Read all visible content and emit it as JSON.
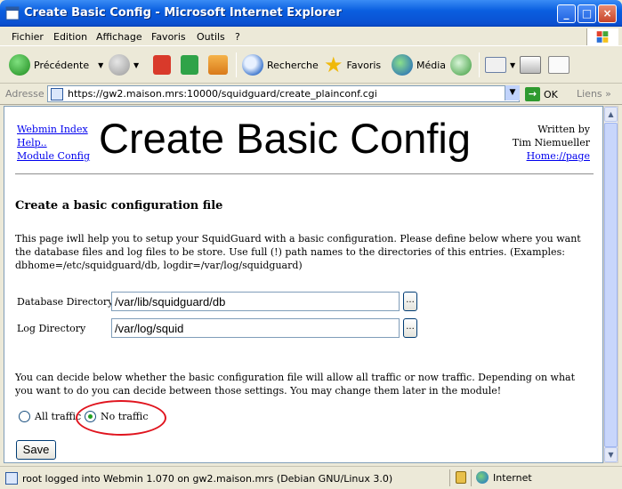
{
  "window": {
    "title": "Create Basic Config - Microsoft Internet Explorer",
    "minimize": "_",
    "maximize": "□",
    "close": "×"
  },
  "menu": [
    "Fichier",
    "Edition",
    "Affichage",
    "Favoris",
    "Outils",
    "?"
  ],
  "toolbar": {
    "back": "Précédente",
    "search": "Recherche",
    "favorites": "Favoris",
    "media": "Média"
  },
  "address": {
    "label": "Adresse",
    "url": "https://gw2.maison.mrs:10000/squidguard/create_plainconf.cgi",
    "go": "OK",
    "links": "Liens"
  },
  "page": {
    "links": [
      "Webmin Index",
      "Help..",
      "Module Config"
    ],
    "title": "Create Basic Config",
    "written_by": "Written by",
    "author": "Tim Niemueller",
    "homepage": "Home://page",
    "heading": "Create a basic configuration file",
    "intro": "This page iwll help you to setup your SquidGuard with a basic configuration. Please define below where you want the database files and log files to be store. Use full (!) path names to the directories of this entries. (Examples: dbhome=/etc/squidguard/db, logdir=/var/log/squidguard)",
    "db_label": "Database Directory",
    "db_value": "/var/lib/squidguard/db",
    "log_label": "Log Directory",
    "log_value": "/var/log/squid",
    "browse": "...",
    "decide": "You can decide below whether the basic configuration file will allow all traffic or now traffic. Depending on what you want to do you can decide between those settings. You may change them later in the module!",
    "radio_all": "All traffic",
    "radio_none": "No traffic",
    "selected": "No traffic",
    "save": "Save"
  },
  "status": {
    "text": "root logged into Webmin 1.070 on gw2.maison.mrs (Debian GNU/Linux 3.0)",
    "zone": "Internet"
  }
}
